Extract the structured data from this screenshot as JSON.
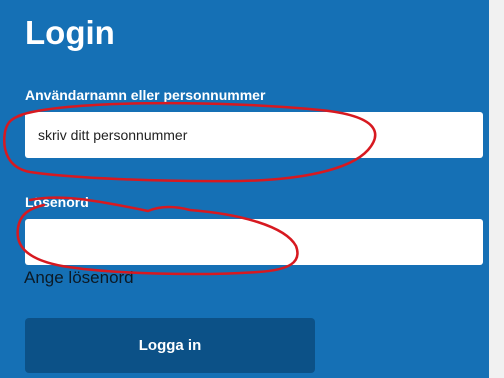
{
  "login_form": {
    "title": "Login",
    "username_label": "Användarnamn eller personnummer",
    "username_placeholder": "skriv ditt personnummer",
    "password_label": "Lösenord",
    "password_value": "",
    "password_hint": "Ange lösenord",
    "submit_label": "Logga in"
  },
  "colors": {
    "panel_background": "#1570b5",
    "button_background": "#0c5187",
    "input_background": "#ffffff",
    "annotation_marker": "#d71920"
  },
  "annotations": {
    "type": "hand-drawn red ellipses",
    "circled_elements": [
      "username-input",
      "password-input"
    ]
  }
}
